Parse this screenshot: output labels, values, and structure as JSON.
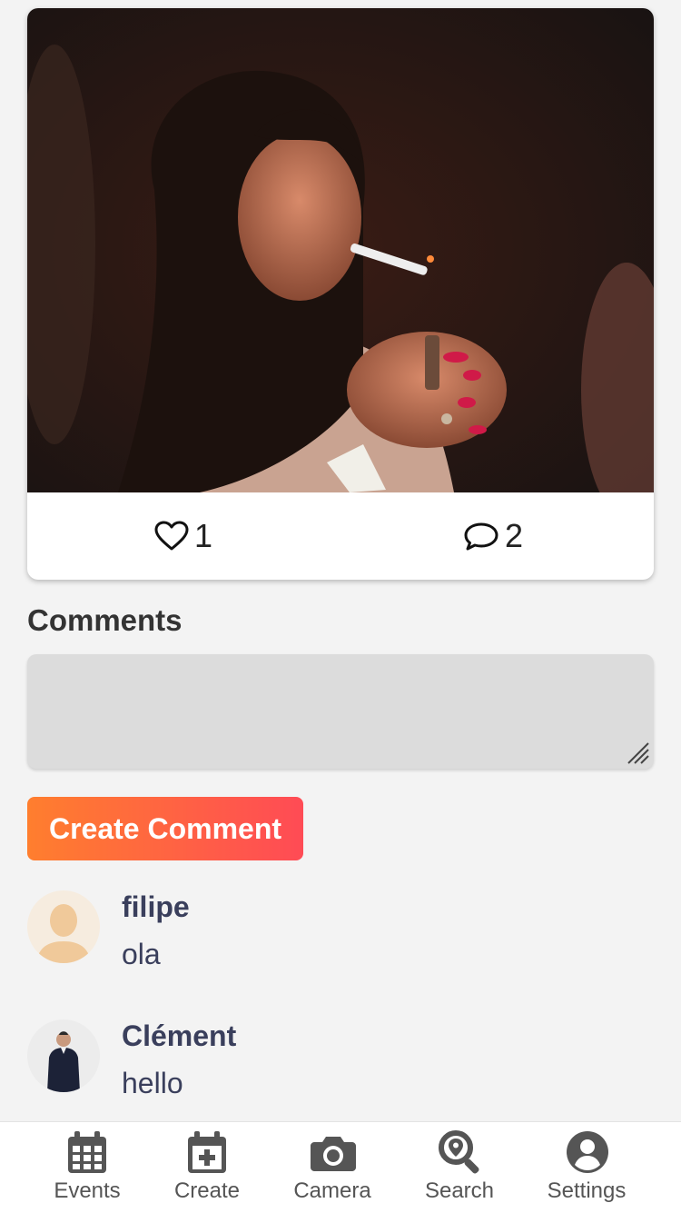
{
  "post": {
    "likes": "1",
    "comments_count": "2"
  },
  "comments_section": {
    "title": "Comments",
    "input_value": "",
    "create_button_label": "Create Comment"
  },
  "comments": [
    {
      "author": "filipe",
      "text": "ola"
    },
    {
      "author": "Clément",
      "text": "hello"
    }
  ],
  "tabbar": {
    "items": [
      {
        "label": "Events",
        "icon": "calendar-grid-icon"
      },
      {
        "label": "Create",
        "icon": "calendar-plus-icon"
      },
      {
        "label": "Camera",
        "icon": "camera-icon"
      },
      {
        "label": "Search",
        "icon": "search-location-icon"
      },
      {
        "label": "Settings",
        "icon": "user-circle-icon"
      }
    ]
  },
  "colors": {
    "button_gradient_start": "#ff7e2e",
    "button_gradient_end": "#ff4b55",
    "comment_name": "#3a3f5c",
    "tab_icon": "#555555"
  }
}
